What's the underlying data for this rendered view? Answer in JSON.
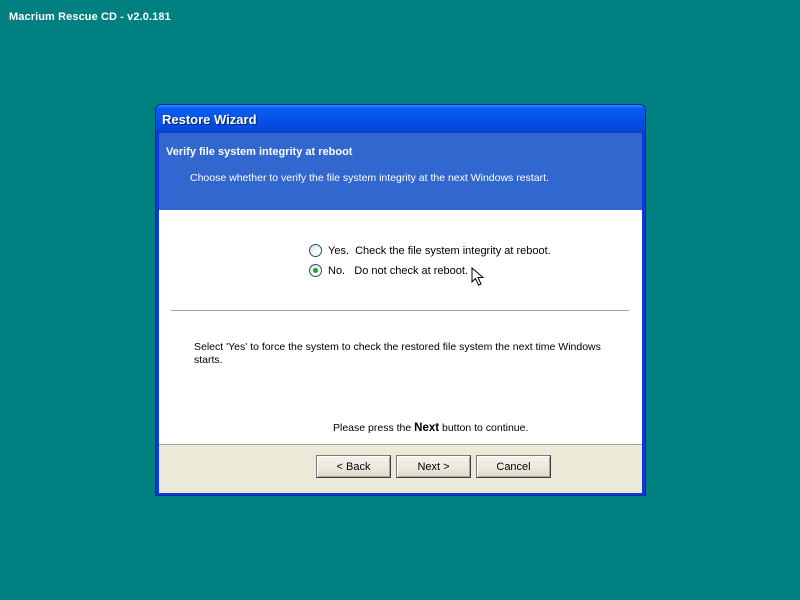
{
  "desktop": {
    "title": "Macrium Rescue CD - v2.0.181"
  },
  "window": {
    "title": "Restore Wizard"
  },
  "header": {
    "title": "Verify file system integrity at reboot",
    "description": "Choose whether to verify the file system integrity at the next Windows restart."
  },
  "options": [
    {
      "label": "Yes.  Check the file system integrity at reboot.",
      "checked": false
    },
    {
      "label": "No.   Do not check at reboot.",
      "checked": true
    }
  ],
  "info": "Select 'Yes' to force the system to check the restored file system the next time Windows starts.",
  "continue": {
    "prefix": "Please press the ",
    "bold": "Next",
    "suffix": " button to continue."
  },
  "buttons": {
    "back": "< Back",
    "next": "Next >",
    "cancel": "Cancel"
  },
  "colors": {
    "desktop": "#008080",
    "header_band": "#3167ce",
    "radio_dot": "#21a121"
  }
}
